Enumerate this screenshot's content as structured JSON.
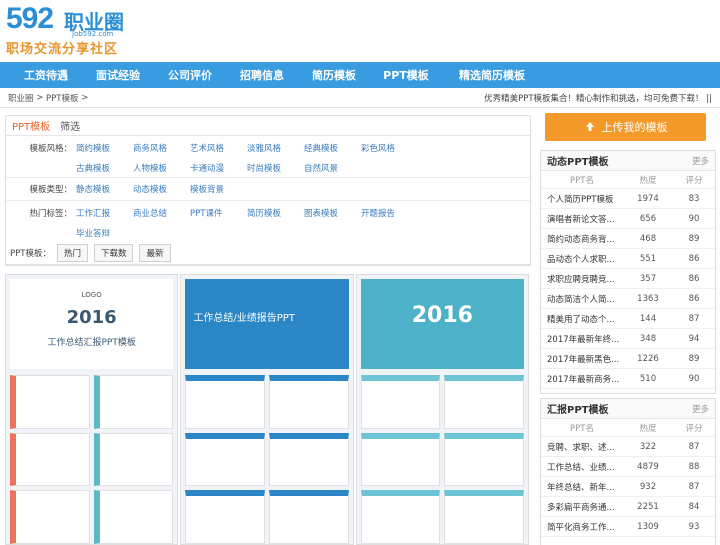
{
  "logo": {
    "num": "592",
    "cn": "职业圈",
    "url": "Job592.com",
    "slogan": "职场交流分享社区"
  },
  "nav": [
    "工资待遇",
    "面试经验",
    "公司评价",
    "招聘信息",
    "简历模板",
    "PPT模板",
    "精选简历模板"
  ],
  "breadcrumb": {
    "home": "职业圈",
    "sep": ">",
    "page": "PPT模板",
    "sep2": ">",
    "notice": "优秀精美PPT模板集合！精心制作和挑选，均可免费下载！ ||"
  },
  "filter": {
    "title": "PPT模板",
    "sub": "筛选",
    "style_label": "模板风格：",
    "styles": [
      "简约模板",
      "商务风格",
      "艺术风格",
      "淡雅风格",
      "经典模板",
      "彩色风格",
      "古典模板",
      "人物模板",
      "卡通动漫",
      "时尚模板",
      "自然风景"
    ],
    "type_label": "模板类型：",
    "types": [
      "静态模板",
      "动态模板",
      "模板背景"
    ],
    "tag_label": "热门标签：",
    "tags": [
      "工作汇报",
      "商业总结",
      "PPT课件",
      "简历模板",
      "图表模板",
      "开题报告",
      "毕业答辩"
    ]
  },
  "sort": {
    "label": "PPT模板：",
    "hot": "热门",
    "downloads": "下载数",
    "latest": "最新"
  },
  "thumbs": {
    "t1": {
      "logo": "LOGO",
      "year": "2016",
      "sub": "工作总结汇报PPT模板"
    },
    "t2": {
      "title": "工作总结/业绩报告PPT"
    },
    "t3": {
      "year": "2016"
    }
  },
  "upload_label": "上传我的模板",
  "panel_dynamic": {
    "title": "动态PPT模板",
    "more": "更多",
    "cols": [
      "PPT名",
      "热度",
      "评分"
    ],
    "rows": [
      [
        "个人简历PPT模板",
        "1974",
        "83"
      ],
      [
        "演唱者新论文答...",
        "656",
        "90"
      ],
      [
        "简约动态商务背...",
        "468",
        "89"
      ],
      [
        "品动态个人求职...",
        "551",
        "86"
      ],
      [
        "求职应聘竞聘竞...",
        "357",
        "86"
      ],
      [
        "动态简洁个人简...",
        "1363",
        "86"
      ],
      [
        "精美用了动态个...",
        "144",
        "87"
      ],
      [
        "2017年最新年终...",
        "348",
        "94"
      ],
      [
        "2017年最新黑色...",
        "1226",
        "89"
      ],
      [
        "2017年最新商务...",
        "510",
        "90"
      ]
    ]
  },
  "panel_report": {
    "title": "汇报PPT模板",
    "more": "更多",
    "cols": [
      "PPT名",
      "热度",
      "评分"
    ],
    "rows": [
      [
        "竞聘、求职、述...",
        "322",
        "87"
      ],
      [
        "工作总结、业绩...",
        "4879",
        "88"
      ],
      [
        "年终总结、新年...",
        "932",
        "87"
      ],
      [
        "多彩扁平商务通...",
        "2251",
        "84"
      ],
      [
        "简平化商务工作...",
        "1309",
        "93"
      ]
    ]
  },
  "colors": {
    "nav": "#3a9ce0",
    "accent": "#f39a2b",
    "link": "#3a7dbf"
  }
}
